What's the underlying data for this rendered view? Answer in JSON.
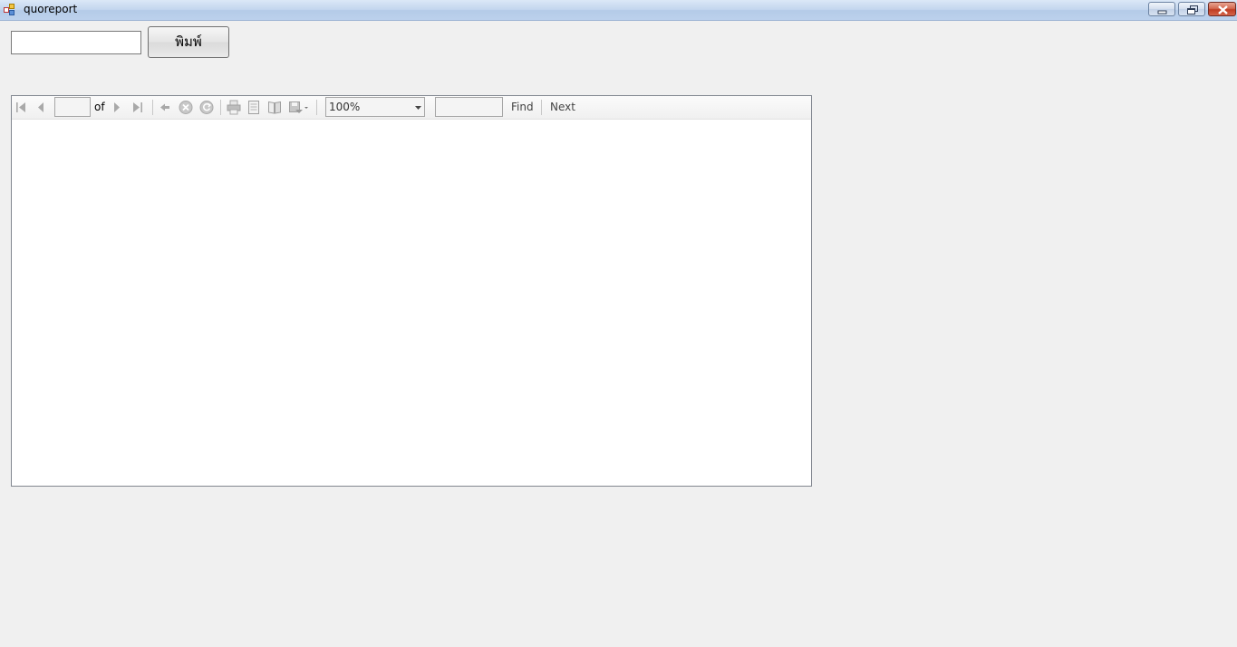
{
  "window": {
    "title": "quoreport",
    "controls": {
      "minimize_icon": "minimize-icon",
      "maximize_icon": "restore-icon",
      "close_icon": "close-icon"
    }
  },
  "form": {
    "input_value": "",
    "print_button_label": "พิมพ์"
  },
  "report_viewer": {
    "toolbar": {
      "page_input_value": "",
      "of_label": "of",
      "zoom_value": "100%",
      "find_input_value": "",
      "find_label": "Find",
      "next_label": "Next",
      "icons": [
        "first-page-icon",
        "previous-page-icon",
        "next-page-icon",
        "last-page-icon",
        "back-icon",
        "stop-icon",
        "refresh-icon",
        "print-icon",
        "print-layout-icon",
        "page-setup-icon",
        "export-icon"
      ]
    }
  },
  "colors": {
    "window_background": "#f0f0f0",
    "titlebar": "#c3d6ee",
    "close_button": "#c03c22",
    "icon_disabled": "#a9a9a9"
  }
}
